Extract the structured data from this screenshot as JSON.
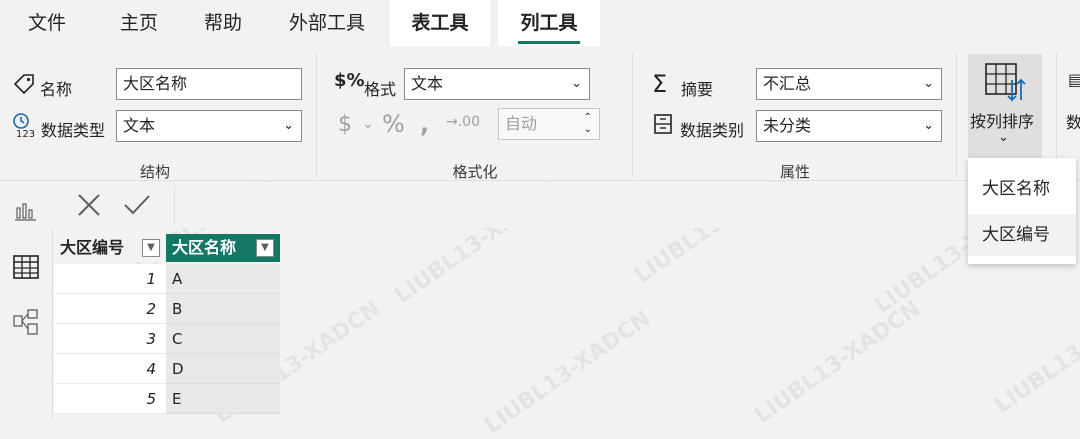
{
  "menu_tabs": [
    {
      "label": "文件"
    },
    {
      "label": "主页"
    },
    {
      "label": "帮助"
    },
    {
      "label": "外部工具"
    },
    {
      "label": "表工具"
    },
    {
      "label": "列工具"
    }
  ],
  "structure": {
    "name_label": "名称",
    "name_value": "大区名称",
    "datatype_label": "数据类型",
    "datatype_value": "文本",
    "group_label": "结构"
  },
  "formatting": {
    "format_label": "格式",
    "format_value": "文本",
    "decimals_value": "自动",
    "group_label": "格式化"
  },
  "properties": {
    "summary_label": "摘要",
    "summary_value": "不汇总",
    "category_label": "数据类别",
    "category_value": "未分类",
    "group_label": "属性"
  },
  "sort_by_column": {
    "label": "按列排序",
    "partial_next": "数",
    "menu_items": [
      "大区名称",
      "大区编号"
    ]
  },
  "table": {
    "columns": [
      "大区编号",
      "大区名称"
    ],
    "rows": [
      {
        "id": "1",
        "name": "A"
      },
      {
        "id": "2",
        "name": "B"
      },
      {
        "id": "3",
        "name": "C"
      },
      {
        "id": "4",
        "name": "D"
      },
      {
        "id": "5",
        "name": "E"
      }
    ]
  },
  "watermark": "LIUBL13-XADCN",
  "colors": {
    "accent": "#117865",
    "selected_column": "#e8e8e8"
  }
}
